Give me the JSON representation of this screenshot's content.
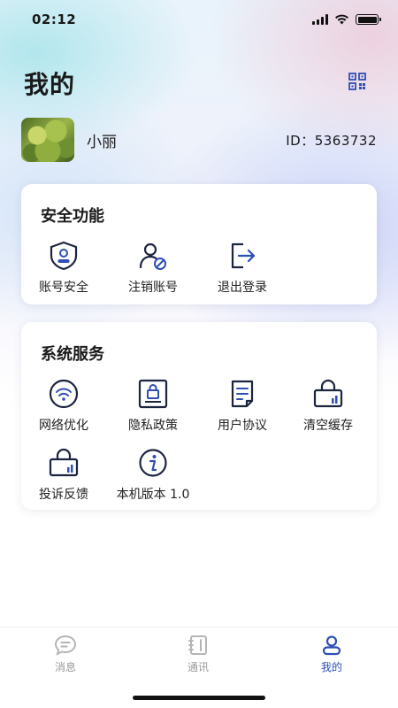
{
  "status_bar": {
    "time": "02:12",
    "icons": [
      "signal-icon",
      "wifi-icon",
      "battery-icon"
    ]
  },
  "header": {
    "title": "我的",
    "qr_icon": "qr-code-icon"
  },
  "profile": {
    "name": "小丽",
    "id_text": "ID：5363732"
  },
  "security": {
    "title": "安全功能",
    "items": [
      {
        "label": "账号安全",
        "icon": "shield-user-icon"
      },
      {
        "label": "注销账号",
        "icon": "user-remove-icon"
      },
      {
        "label": "退出登录",
        "icon": "logout-icon"
      }
    ]
  },
  "services": {
    "title": "系统服务",
    "items": [
      {
        "label": "网络优化",
        "icon": "wifi-icon"
      },
      {
        "label": "隐私政策",
        "icon": "privacy-lock-icon"
      },
      {
        "label": "用户协议",
        "icon": "document-icon"
      },
      {
        "label": "清空缓存",
        "icon": "lock-bag-icon"
      },
      {
        "label": "投诉反馈",
        "icon": "lock-bag-icon"
      },
      {
        "label": "本机版本 1.0",
        "icon": "info-icon"
      }
    ]
  },
  "tab_bar": {
    "tabs": [
      {
        "label": "消息",
        "icon": "chat-icon",
        "active": false
      },
      {
        "label": "通讯",
        "icon": "contacts-book-icon",
        "active": false
      },
      {
        "label": "我的",
        "icon": "user-icon",
        "active": true
      }
    ]
  },
  "colors": {
    "accent": "#2f4eb4",
    "icon_dark": "#1c2540",
    "inactive": "#9a9a9a"
  }
}
